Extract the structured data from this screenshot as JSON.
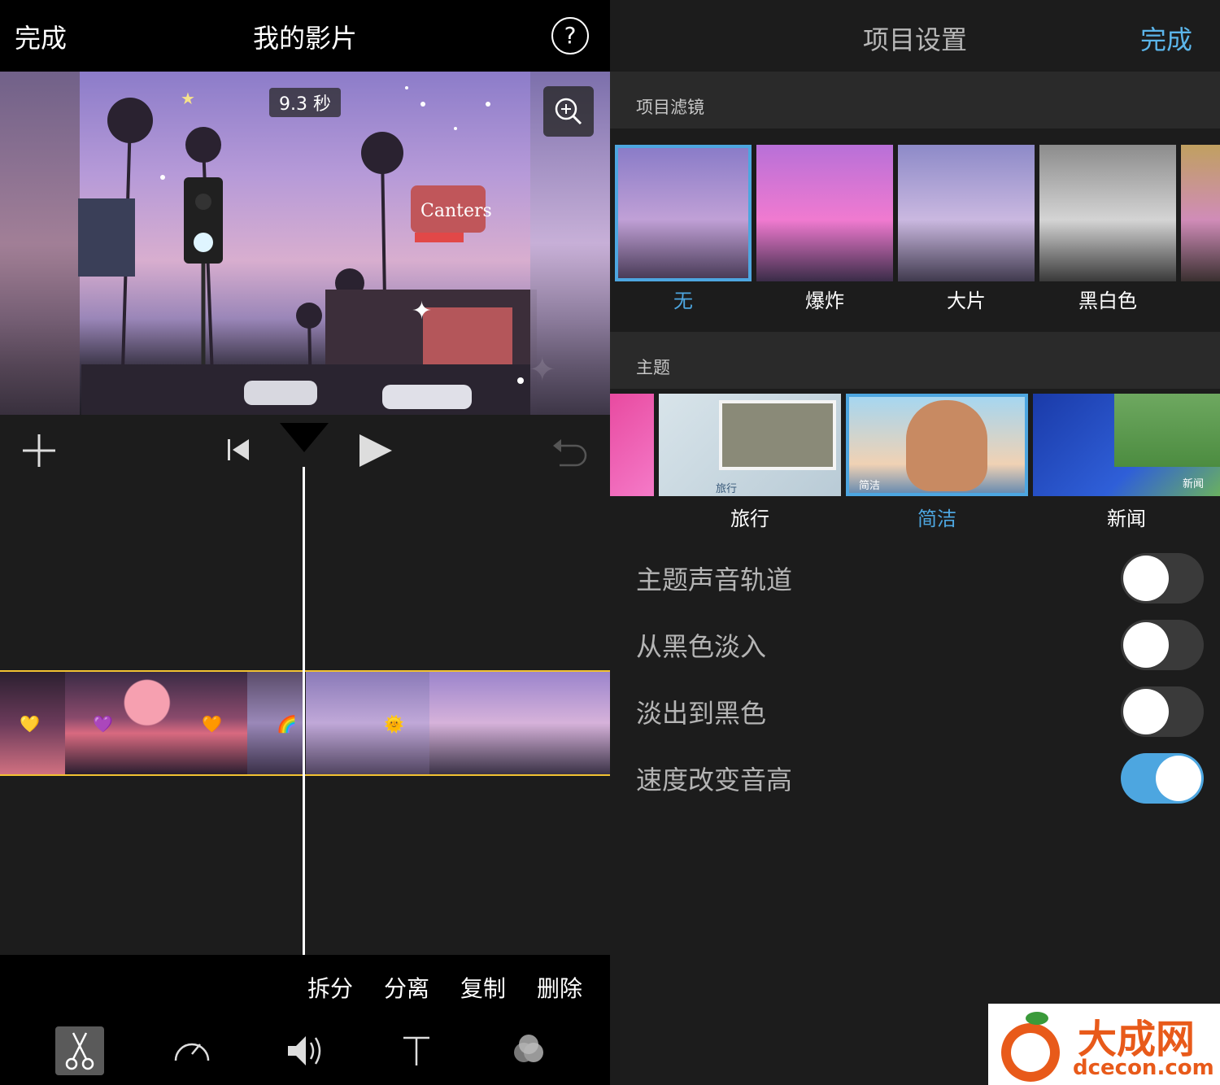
{
  "left_panel": {
    "header": {
      "done_label": "完成",
      "title": "我的影片",
      "help_label": "?"
    },
    "preview": {
      "duration_label": "9.3 秒"
    },
    "edit_actions": [
      "拆分",
      "分离",
      "复制",
      "删除"
    ],
    "tools": [
      {
        "name": "scissors-icon"
      },
      {
        "name": "speedometer-icon"
      },
      {
        "name": "speaker-icon"
      },
      {
        "name": "text-icon"
      },
      {
        "name": "filter-circles-icon"
      }
    ],
    "clip_emojis": [
      "💛",
      "💜",
      "🧡",
      "🌈",
      "🌞"
    ]
  },
  "right_panel": {
    "header": {
      "title": "项目设置",
      "done_label": "完成"
    },
    "filters": {
      "section_label": "项目滤镜",
      "items": [
        {
          "label": "无",
          "selected": true
        },
        {
          "label": "爆炸",
          "selected": false
        },
        {
          "label": "大片",
          "selected": false
        },
        {
          "label": "黑白色",
          "selected": false
        }
      ]
    },
    "themes": {
      "section_label": "主题",
      "items": [
        {
          "label": "旅行",
          "thumb_caption": "旅行",
          "selected": false
        },
        {
          "label": "简洁",
          "thumb_caption": "简洁",
          "selected": true
        },
        {
          "label": "新闻",
          "thumb_caption": "新闻",
          "selected": false
        }
      ]
    },
    "settings": [
      {
        "label": "主题声音轨道",
        "on": false
      },
      {
        "label": "从黑色淡入",
        "on": false
      },
      {
        "label": "淡出到黑色",
        "on": false
      },
      {
        "label": "速度改变音高",
        "on": true
      }
    ]
  },
  "watermark": {
    "cn": "大成网",
    "en": "dcecon.com"
  },
  "colors": {
    "accent": "#4da6e0",
    "done_blue": "#5bb5ea",
    "timeline_border": "#f1c232",
    "watermark": "#e85a1a"
  }
}
